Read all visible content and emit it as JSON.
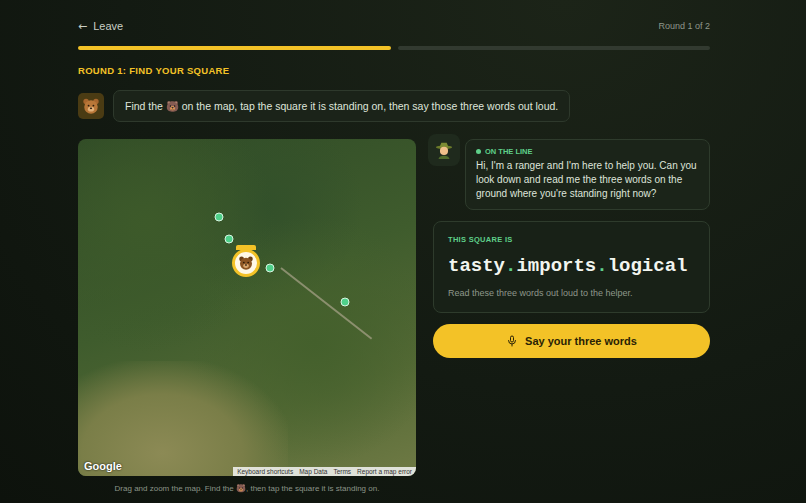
{
  "header": {
    "back_icon": "←",
    "back_label": "Leave",
    "round": "Round 1 of 2"
  },
  "progress": [
    {
      "filled": true
    },
    {
      "filled": false
    }
  ],
  "round_title": "ROUND 1: FIND YOUR SQUARE",
  "instruction": "Find the 🐻 on the map, tap the square it is standing on, then say those three words out loud.",
  "map": {
    "logo": "Google",
    "attribution": [
      "Keyboard shortcuts",
      "Map Data",
      "Terms",
      "Report a map error"
    ],
    "markers": [
      {
        "kind": "waypoint"
      },
      {
        "kind": "waypoint"
      },
      {
        "kind": "waypoint"
      },
      {
        "kind": "waypoint"
      },
      {
        "kind": "bear"
      }
    ],
    "caption": "Drag and zoom the map. Find the 🐻, then tap the square it is standing on."
  },
  "helper": {
    "status": "ON THE LINE",
    "live": true,
    "message": "Hi, I'm a ranger and I'm here to help you. Can you look down and read me the three words on the ground where you're standing right now?"
  },
  "square": {
    "label": "THIS SQUARE IS",
    "words": [
      "tasty",
      "imports",
      "logical"
    ],
    "separator": ".",
    "hint": "Read these three words out loud to the helper."
  },
  "action": {
    "label": "Say your three words"
  }
}
